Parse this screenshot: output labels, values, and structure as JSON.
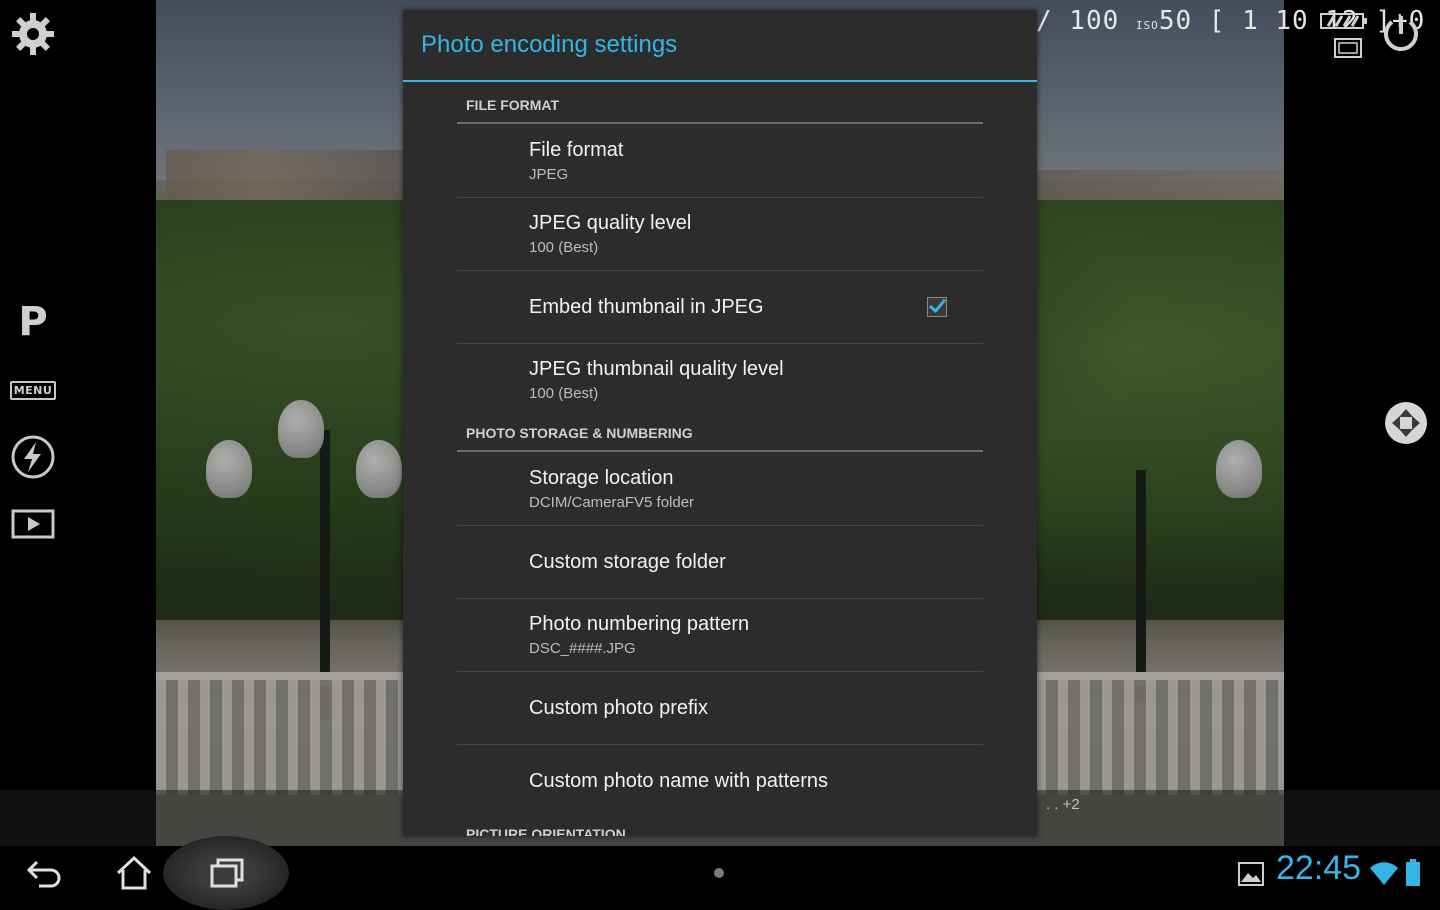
{
  "camera": {
    "mode_letter": "P",
    "menu_label": "MENU",
    "readout": {
      "shutter": "/ 100",
      "iso_label": "ISO",
      "iso": "50",
      "shots": "[ 1 10 12 ]+0"
    },
    "ev_readout": ". . +2"
  },
  "dialog": {
    "title": "Photo encoding settings",
    "sections": {
      "file_format": "FILE FORMAT",
      "storage": "PHOTO STORAGE & NUMBERING",
      "orientation": "PICTURE ORIENTATION"
    },
    "prefs": {
      "file_format": {
        "title": "File format",
        "summary": "JPEG"
      },
      "jpeg_quality": {
        "title": "JPEG quality level",
        "summary": "100 (Best)"
      },
      "embed_thumb": {
        "title": "Embed thumbnail in JPEG",
        "checked": true
      },
      "thumb_quality": {
        "title": "JPEG thumbnail quality level",
        "summary": "100 (Best)"
      },
      "storage_location": {
        "title": "Storage location",
        "summary": "DCIM/CameraFV5 folder"
      },
      "custom_folder": {
        "title": "Custom storage folder"
      },
      "numbering": {
        "title": "Photo numbering pattern",
        "summary": "DSC_####.JPG"
      },
      "prefix": {
        "title": "Custom photo prefix"
      },
      "name_patterns": {
        "title": "Custom photo name with patterns"
      }
    }
  },
  "system": {
    "clock": "22:45"
  },
  "colors": {
    "accent": "#33b5e5",
    "dialog_bg": "#2c2c2c"
  },
  "icons": [
    "gear-icon",
    "flash-auto-icon",
    "play-icon",
    "power-icon",
    "shutter-icon",
    "battery-icon",
    "memory-card-icon",
    "back-icon",
    "home-icon",
    "recent-apps-icon",
    "gallery-icon",
    "wifi-icon"
  ]
}
